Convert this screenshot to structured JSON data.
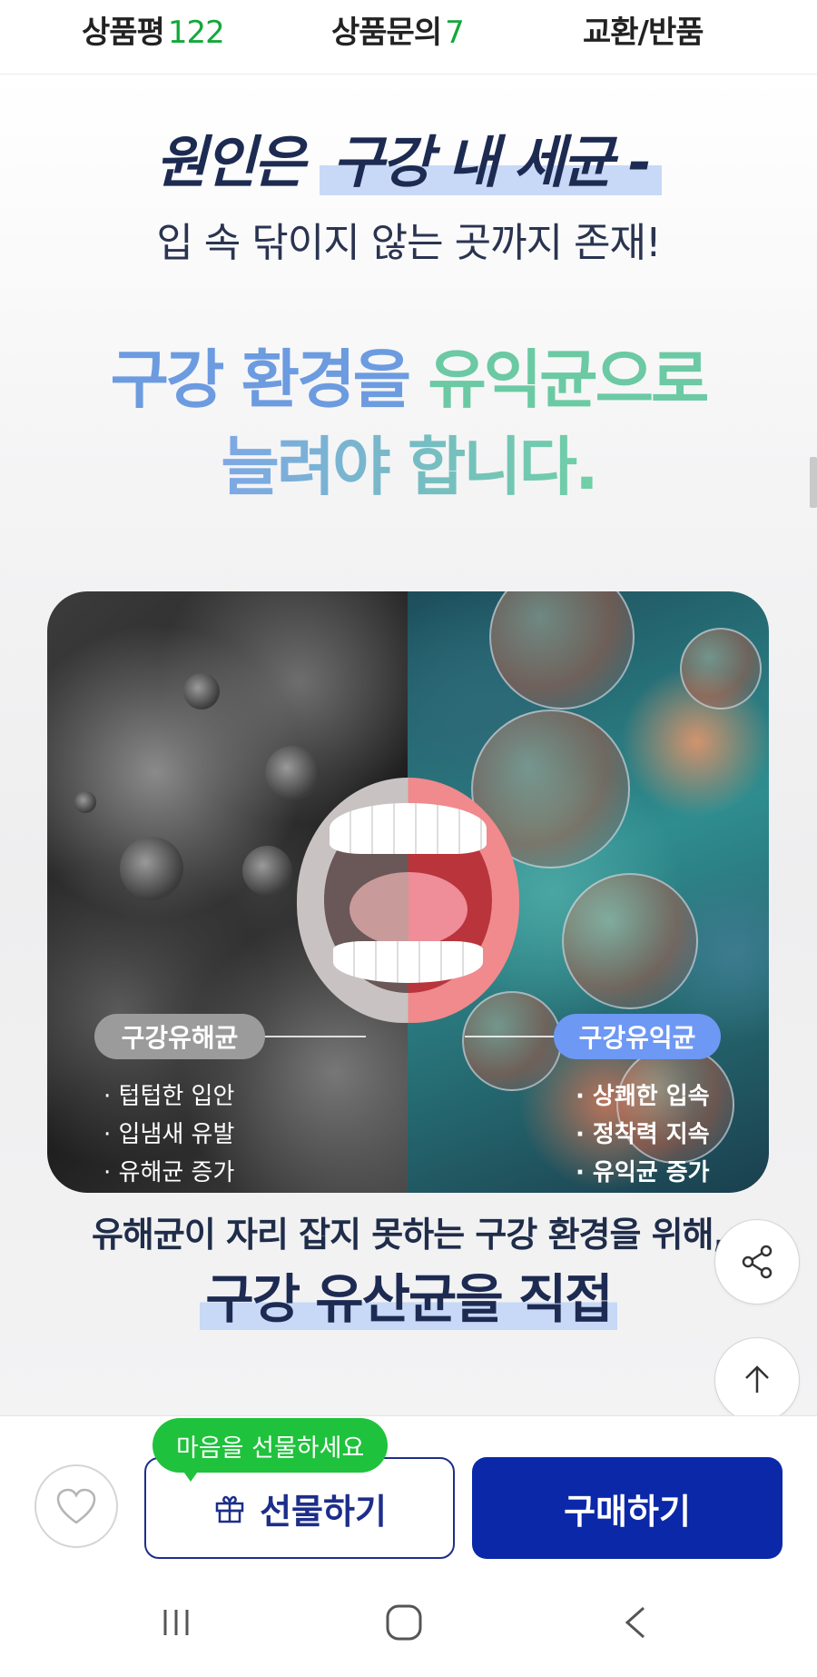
{
  "tabs": {
    "reviews_label": "상품평",
    "reviews_count": "122",
    "inquiry_label": "상품문의",
    "inquiry_count": "7",
    "exchange_label": "교환/반품"
  },
  "hero": {
    "title_prefix": "원인은 ",
    "title_highlight": "구강 내 세균 -",
    "subtitle": "입 속 닦이지 않는 곳까지 존재!",
    "headline_line1_a": "구강 환경을 ",
    "headline_line1_b": "유익균으로",
    "headline_line2": "늘려야 합니다."
  },
  "comparison": {
    "bad_label": "구강유해균",
    "bad_features": [
      "· 텁텁한 입안",
      "· 입냄새 유발",
      "· 유해균 증가"
    ],
    "good_label": "구강유익균",
    "good_features": [
      "· 상쾌한 입속",
      "· 정착력 지속",
      "· 유익균 증가"
    ]
  },
  "body": {
    "line1": "유해균이 자리 잡지 못하는 구강 환경을 위해,",
    "line2": "구강 유산균을 직접"
  },
  "floating": {
    "share_icon": "share-icon",
    "top_icon": "arrow-up-icon"
  },
  "actions": {
    "tooltip": "마음을 선물하세요",
    "gift_label": "선물하기",
    "buy_label": "구매하기",
    "wishlist_icon": "heart-icon"
  },
  "colors": {
    "accent_green": "#13a83a",
    "primary_blue": "#0a28a8",
    "tooltip_green": "#1fc23c",
    "headline_blue": "#6c9be0",
    "headline_green": "#6bc9a3"
  }
}
